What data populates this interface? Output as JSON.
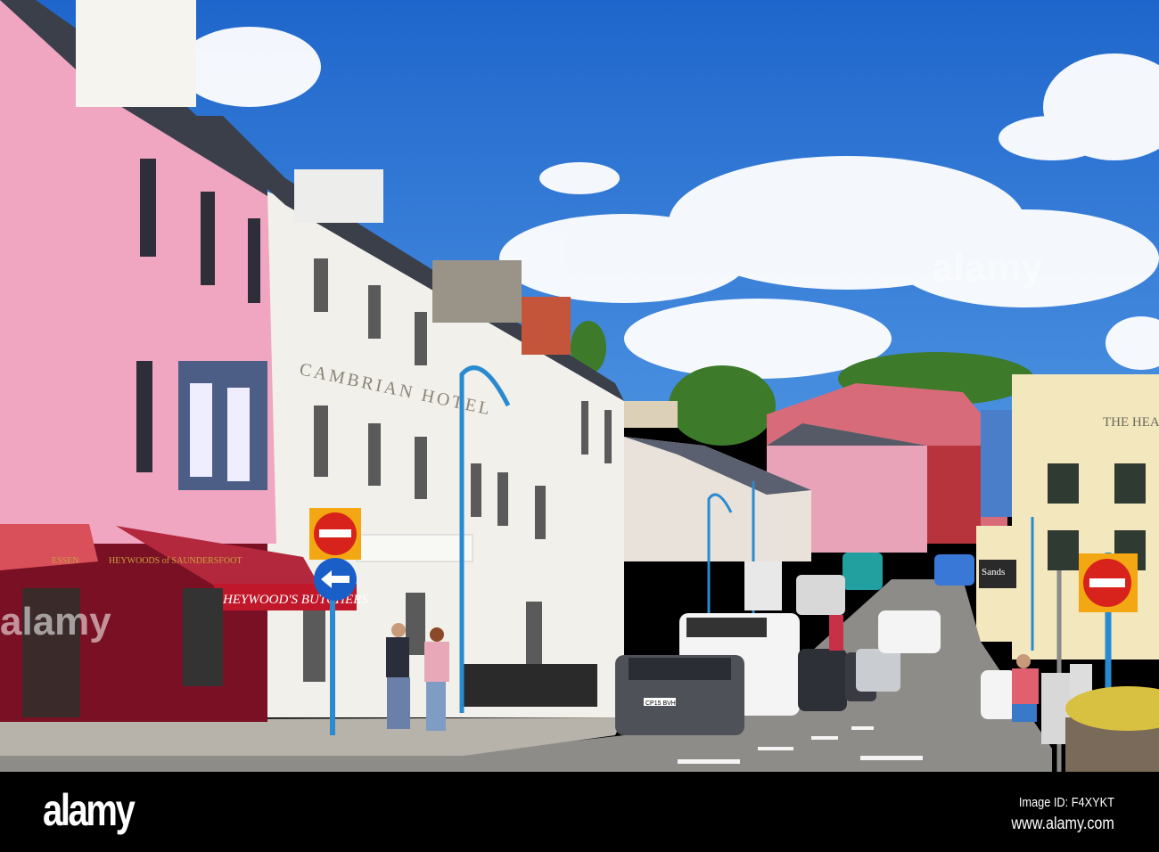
{
  "photo": {
    "hotel_sign": "CAMBRIAN HOTEL",
    "awning_sign": "HEYWOOD'S BUTCHERS",
    "shop_sign_left": "ESSEN",
    "shop_sign_main": "HEYWOODS of SAUNDERSFOOT",
    "corner_building_sign": "THE HEA",
    "cafe_sign": "Sands",
    "number_plate": "CP15 BVH",
    "watermark_center": "alamy",
    "watermark_left": "alamy"
  },
  "footer": {
    "logo": "alamy",
    "image_id": "Image ID: F4XYKT",
    "website": "www.alamy.com"
  },
  "colors": {
    "sky": "#2a72d2",
    "pink_building": "#f0a6c0",
    "white_building": "#f2f0ea",
    "awning_red": "#a8203a",
    "sign_blue": "#1a5fc8",
    "no_entry_red": "#d8231c",
    "road": "#8e8c88"
  }
}
